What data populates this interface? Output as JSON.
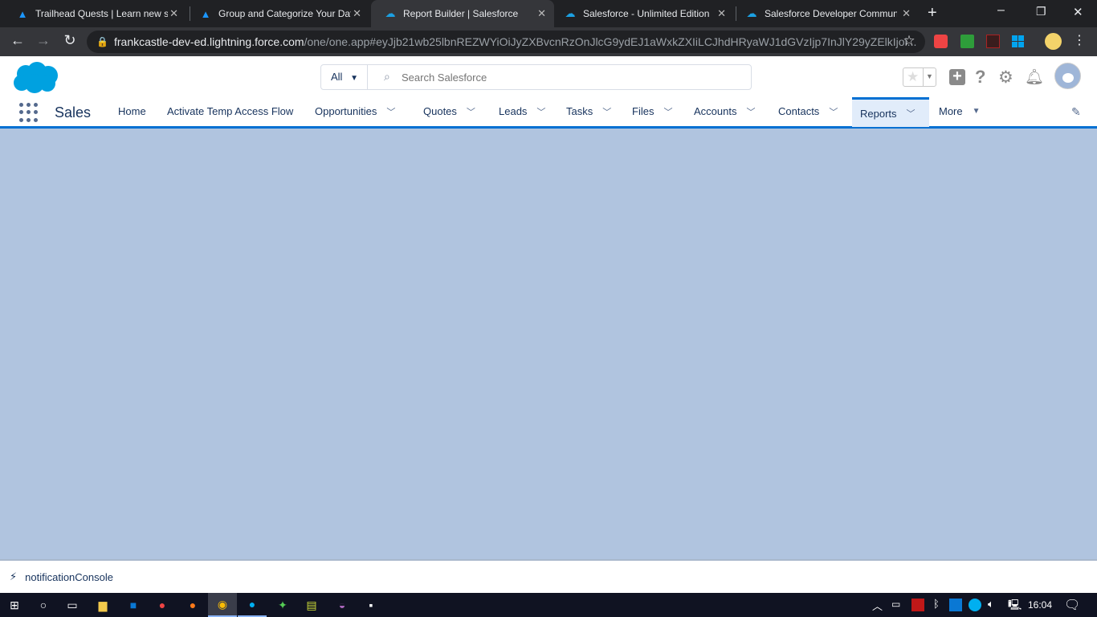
{
  "browser": {
    "tabs": [
      {
        "title": "Trailhead Quests | Learn new skills",
        "icon": "trailhead-icon",
        "active": false
      },
      {
        "title": "Group and Categorize Your Data",
        "icon": "trailhead-icon",
        "active": false
      },
      {
        "title": "Report Builder | Salesforce",
        "icon": "salesforce-cloud-icon",
        "active": true
      },
      {
        "title": "Salesforce - Unlimited Edition",
        "icon": "salesforce-cloud-icon",
        "active": false
      },
      {
        "title": "Salesforce Developer Community",
        "icon": "salesforce-cloud-icon",
        "active": false
      }
    ],
    "url_host": "frankcastle-dev-ed.lightning.force.com",
    "url_path": "/one/one.app#eyJjb21wb25lbnREZWYiOiJyZXBvcnRzOnJlcG9ydEJ1aWxkZXIiLCJhdHRyaWJ1dGVzIjp7InJlY29yZElkIjoi..."
  },
  "header": {
    "search_scope": "All",
    "search_placeholder": "Search Salesforce"
  },
  "nav": {
    "app_name": "Sales",
    "items": [
      {
        "label": "Home",
        "dropdown": false
      },
      {
        "label": "Activate Temp Access Flow",
        "dropdown": false
      },
      {
        "label": "Opportunities",
        "dropdown": true
      },
      {
        "label": "Quotes",
        "dropdown": true
      },
      {
        "label": "Leads",
        "dropdown": true
      },
      {
        "label": "Tasks",
        "dropdown": true
      },
      {
        "label": "Files",
        "dropdown": true
      },
      {
        "label": "Accounts",
        "dropdown": true
      },
      {
        "label": "Contacts",
        "dropdown": true
      },
      {
        "label": "Reports",
        "dropdown": true,
        "active": true
      }
    ],
    "more_label": "More"
  },
  "footer": {
    "utility_label": "notificationConsole"
  },
  "taskbar": {
    "time": "16:04"
  },
  "colors": {
    "brand": "#0070d2",
    "content_bg": "#b0c4df"
  }
}
